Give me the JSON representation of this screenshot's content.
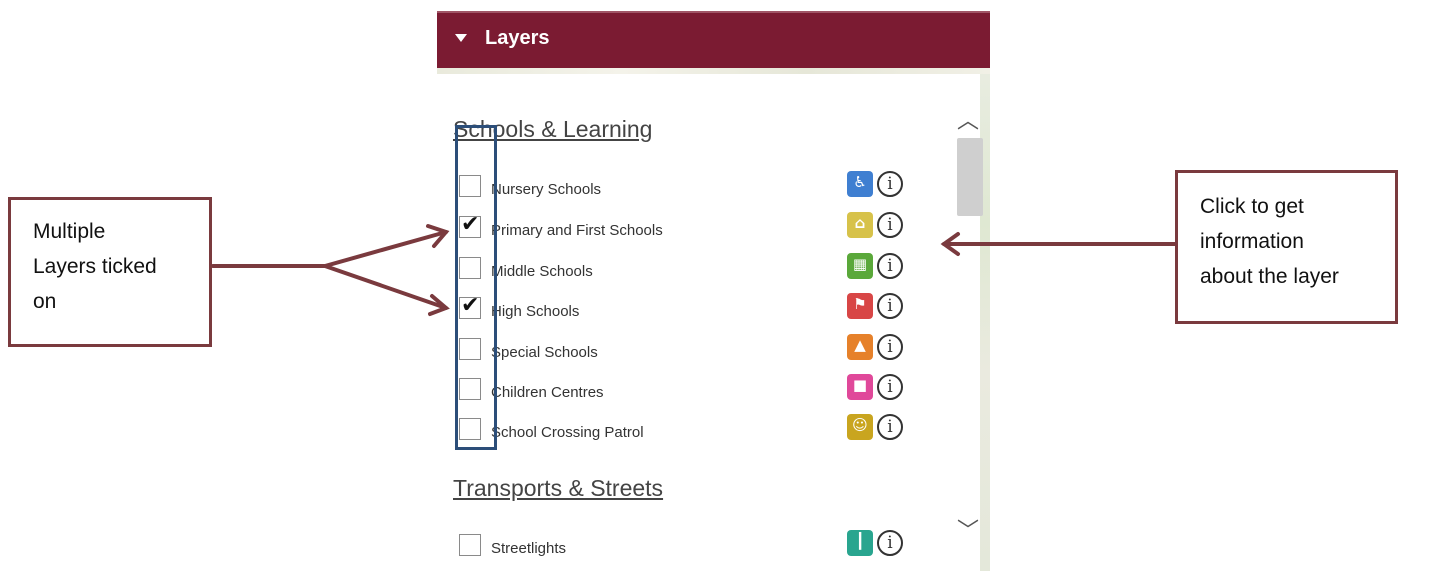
{
  "panel": {
    "title": "Layers",
    "sections": [
      {
        "title": "Schools & Learning",
        "items": [
          {
            "label": "Nursery Schools",
            "checked": false,
            "icon": "nursery-icon",
            "color": "#3f7fd1"
          },
          {
            "label": "Primary and First Schools",
            "checked": true,
            "icon": "primary-school-icon",
            "color": "#d7c24a"
          },
          {
            "label": "Middle Schools",
            "checked": false,
            "icon": "middle-school-icon",
            "color": "#5aa83a"
          },
          {
            "label": "High Schools",
            "checked": true,
            "icon": "high-school-icon",
            "color": "#d84646"
          },
          {
            "label": "Special Schools",
            "checked": false,
            "icon": "special-school-icon",
            "color": "#e6812a"
          },
          {
            "label": "Children Centres",
            "checked": false,
            "icon": "children-centre-icon",
            "color": "#e0489a"
          },
          {
            "label": "School Crossing Patrol",
            "checked": false,
            "icon": "crossing-patrol-icon",
            "color": "#c9a51f"
          }
        ]
      },
      {
        "title": "Transports & Streets",
        "items": [
          {
            "label": "Streetlights",
            "checked": false,
            "icon": "streetlight-icon",
            "color": "#29a58f"
          }
        ]
      }
    ],
    "tick_glyph": "✔",
    "info_glyph": "i"
  },
  "callouts": {
    "left_lines": [
      "Multiple",
      "Layers ticked",
      "on"
    ],
    "right_lines": [
      "Click to get",
      "information",
      "about the layer"
    ]
  },
  "colors": {
    "header": "#7b1b32",
    "callout_border": "#7a3a3e",
    "info_highlight": "#2c4e79"
  }
}
